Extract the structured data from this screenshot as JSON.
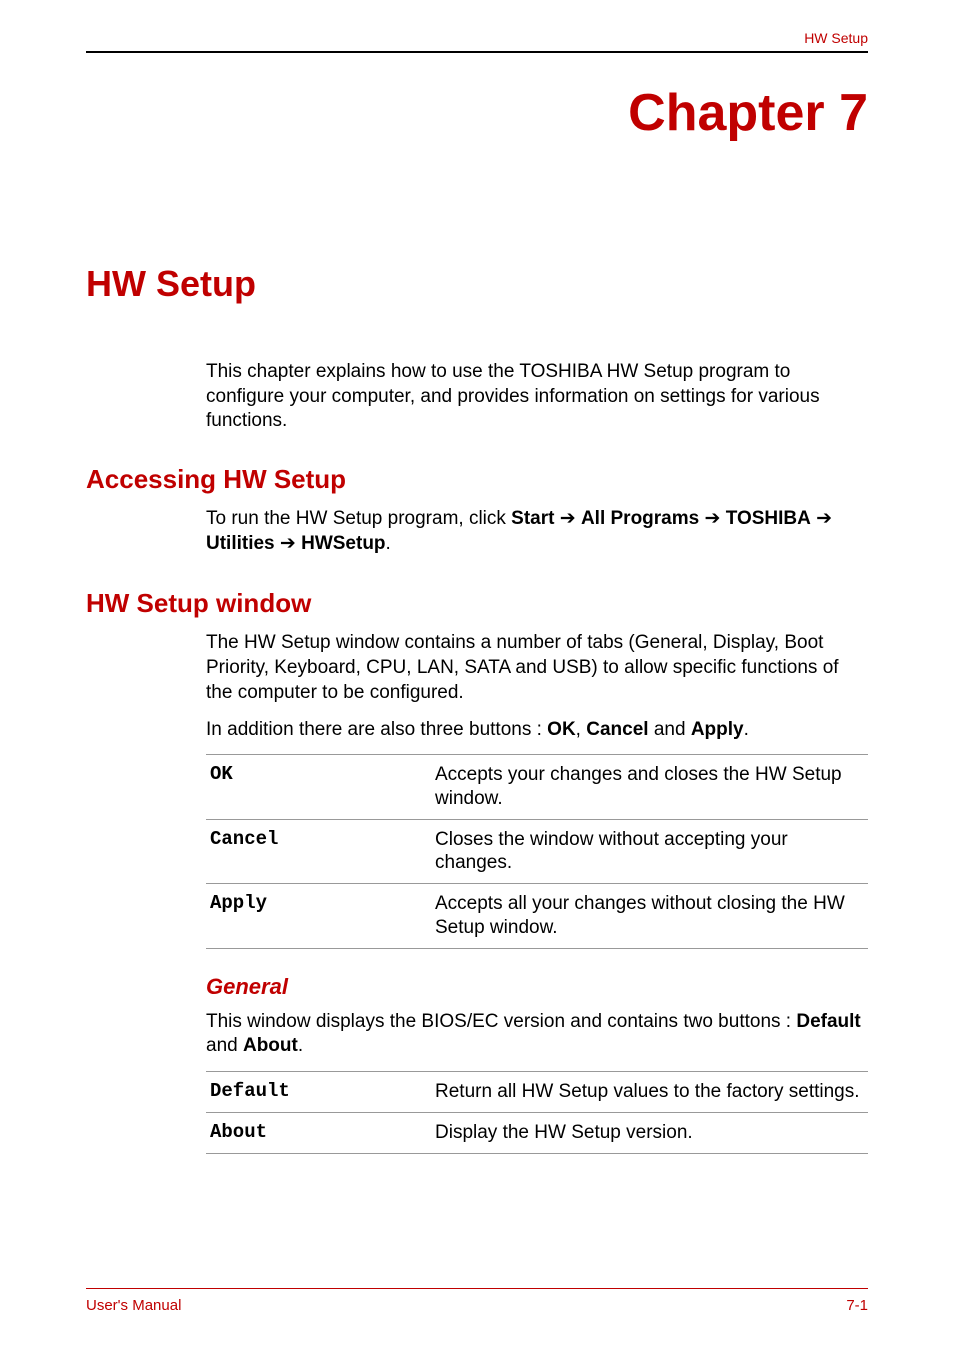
{
  "header": {
    "running_head": "HW Setup"
  },
  "chapter": {
    "label": "Chapter 7",
    "title": "HW Setup"
  },
  "intro": "This chapter explains how to use the TOSHIBA HW Setup program to configure your computer, and provides information on settings for various functions.",
  "accessing": {
    "heading": "Accessing HW Setup",
    "text_prefix": "To run the HW Setup program, click ",
    "path_start": "Start",
    "arrow": " ➔ ",
    "path_all_programs": "All Programs",
    "path_toshiba": "TOSHIBA",
    "path_utilities": "Utilities",
    "path_hwsetup": "HWSetup",
    "period": "."
  },
  "window": {
    "heading": "HW Setup window",
    "para1": "The HW Setup window contains a number of tabs (General, Display, Boot Priority, Keyboard, CPU, LAN, SATA and USB) to allow specific functions of the computer to be configured.",
    "para2_prefix": "In addition there are also three buttons : ",
    "para2_b1": "OK",
    "para2_sep": ", ",
    "para2_b2": "Cancel",
    "para2_and": " and ",
    "para2_b3": "Apply",
    "para2_period": ".",
    "buttons_table": [
      {
        "term": "OK",
        "desc": "Accepts your changes and closes the HW Setup window."
      },
      {
        "term": "Cancel",
        "desc": "Closes the window without accepting your changes."
      },
      {
        "term": "Apply",
        "desc": "Accepts all your changes without closing the HW Setup window."
      }
    ]
  },
  "general": {
    "heading": "General",
    "para_prefix": "This window displays the BIOS/EC version and contains two buttons : ",
    "b1": "Default",
    "and": " and ",
    "b2": "About",
    "period": ".",
    "table": [
      {
        "term": "Default",
        "desc": "Return all HW Setup values to the factory settings."
      },
      {
        "term": "About",
        "desc": "Display the HW Setup version."
      }
    ]
  },
  "footer": {
    "left": "User's Manual",
    "right": "7-1"
  }
}
